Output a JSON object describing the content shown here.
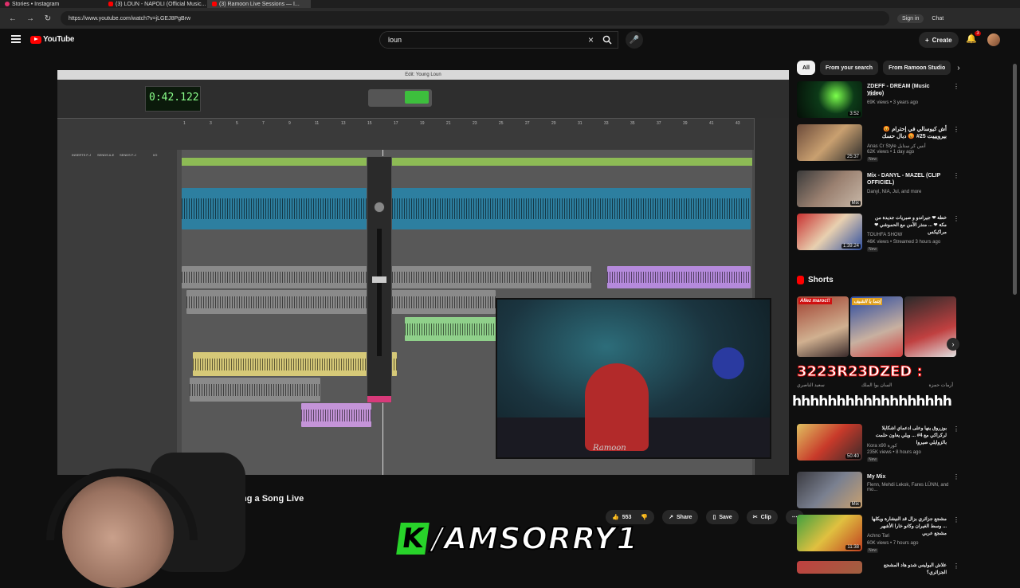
{
  "browser": {
    "tabs": [
      {
        "label": "Stories • Instagram"
      },
      {
        "label": "(3) LOUN - NAPOLI (Official Music..."
      },
      {
        "label": "(3) Ramoon Live Sessions — I..."
      }
    ],
    "url": "https://www.youtube.com/watch?v=jLGEJ8PgBrw",
    "signin_label": "Sign in",
    "chat_label": "Chat"
  },
  "header": {
    "logo_text": "YouTube",
    "search_value": "loun",
    "create_label": "Create",
    "notif_count": "3"
  },
  "player": {
    "daw_title": "Edit: Young Loun",
    "counter": "0:42.122",
    "ruler_ticks": [
      "1",
      "3",
      "5",
      "7",
      "9",
      "11",
      "13",
      "15",
      "17",
      "19",
      "21",
      "23",
      "25",
      "27",
      "29",
      "31",
      "33",
      "35",
      "37",
      "39",
      "41",
      "43"
    ],
    "mixer_labels": [
      "INSERTS F-J",
      "SENDS A-E",
      "SENDS F-J",
      "I/O"
    ],
    "cam_signature": "Ramoon"
  },
  "video": {
    "title_partial": "ing a Song Live",
    "like_count": "553",
    "share_label": "Share",
    "save_label": "Save",
    "clip_label": "Clip"
  },
  "overlay": {
    "k_letter": "K",
    "handle": "/AMSORRY1"
  },
  "sidebar": {
    "chips": [
      "All",
      "From your search",
      "From Ramoon Studio"
    ],
    "recos": [
      {
        "title": "ZDEFF - DREAM (Music Video)",
        "channel": "ZDEFF",
        "meta": "69K views • 3 years ago",
        "duration": "3:52",
        "new": ""
      },
      {
        "title": "أش كيوسالي في إحترام 😡 بيرويييت 25# 😡 دبال حسك",
        "channel": "Anas Cr Style أنس كر ستايل",
        "meta": "62K views • 1 day ago",
        "duration": "25:37",
        "new": "New"
      },
      {
        "title": "Mix - DANYL - MAZEL (CLIP OFFICIEL)",
        "channel": "Danyl, NIA, Jul, and more",
        "meta": "",
        "duration": "Mix",
        "new": ""
      },
      {
        "title": "خطة ❤ جيراندو و صبريات جديدة من مكة ❤ ... منذر الأمن مع الحموشي ❤ مراكيكس",
        "channel": "TOUHFA SHOW",
        "meta": "46K views • Streamed 3 hours ago",
        "duration": "1:39:24",
        "new": "New"
      },
      {
        "title": "بوزروق ينها وعلى ادعماي اشكايلا لركراكي مع 4# ... ويلي يعاون حلمت بالزوايلي صيروا",
        "channel": "Kora x90 كورة",
        "meta": "235K views • 8 hours ago",
        "duration": "50:40",
        "new": "New"
      },
      {
        "title": "My Mix",
        "channel": "Flenn, Mehdi Lekok, Fares LÜNN, and mo...",
        "meta": "",
        "duration": "Mix",
        "new": ""
      },
      {
        "title": "مشجع جزائري بزال قد النيشارة ويكلها ... وسط الغيران وكانو خارا الأشهر مشجع عربي",
        "channel": "Achno Tari",
        "meta": "60K views • 7 hours ago",
        "duration": "11:38",
        "new": "New"
      },
      {
        "title": "علاش البوليس شدو هاد المشجع الجزائري؟",
        "channel": "",
        "meta": "",
        "duration": "",
        "new": ""
      }
    ],
    "shorts_label": "Shorts",
    "shorts_captions": [
      "Allez maroc!!",
      "إنتما يا الشيف",
      ""
    ],
    "chat_line_1": "3223R23DZED :",
    "chat_names": [
      "سعيد الناصري",
      "السان يوا الملك",
      "أزمات حمزة"
    ],
    "chat_line_2": "hhhhhhhhhhhhhhhhhhhhhhhh"
  }
}
